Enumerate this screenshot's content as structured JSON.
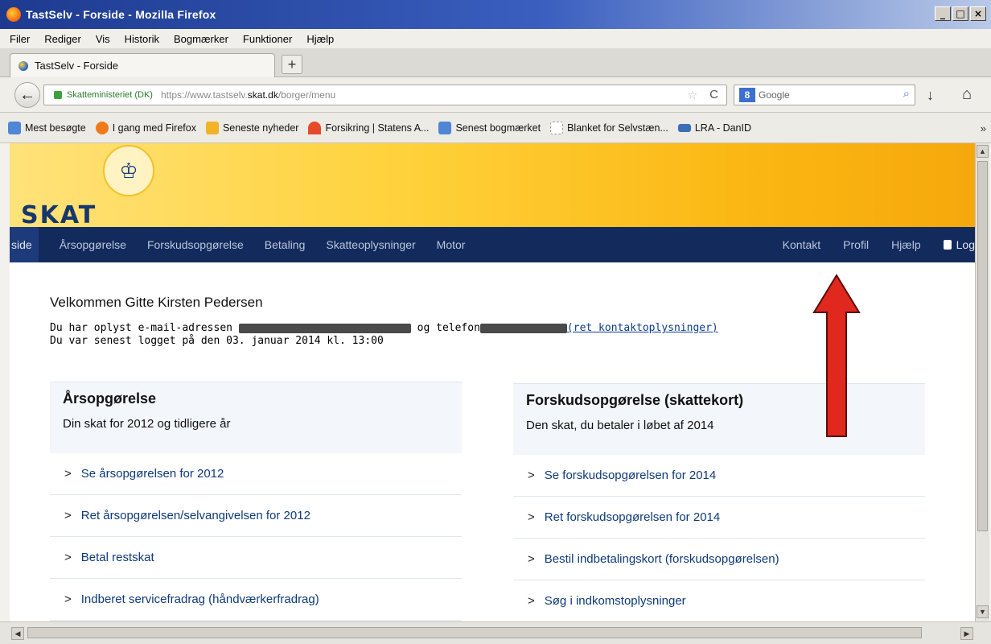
{
  "window": {
    "title": "TastSelv - Forside - Mozilla Firefox",
    "controls": [
      "_",
      "□",
      "×"
    ]
  },
  "menu": [
    "Filer",
    "Rediger",
    "Vis",
    "Historik",
    "Bogmærker",
    "Funktioner",
    "Hjælp"
  ],
  "tab": {
    "label": "TastSelv - Forside",
    "new_tab": "+"
  },
  "navbar": {
    "back": "←",
    "identity": "Skatteministeriet (DK)",
    "url_prefix": "https://www.tastselv.",
    "url_domain": "skat.dk",
    "url_suffix": "/borger/menu",
    "star": "☆",
    "reload": "C",
    "search_engine": "8",
    "search_placeholder": "Google",
    "search_go": "⌕",
    "download": "↓",
    "home": "⌂"
  },
  "bookmarks": [
    {
      "label": "Mest besøgte",
      "icon": "folder-icon",
      "color": "#4f86d6"
    },
    {
      "label": "I gang med Firefox",
      "icon": "firefox-icon",
      "color": "#f07a1a"
    },
    {
      "label": "Seneste nyheder",
      "icon": "rss-icon",
      "color": "#f2b328"
    },
    {
      "label": "Forsikring | Statens A...",
      "icon": "arc-icon",
      "color": "#e44a2b"
    },
    {
      "label": "Senest bogmærket",
      "icon": "folder-icon",
      "color": "#4f86d6"
    },
    {
      "label": "Blanket for Selvstæn...",
      "icon": "page-icon",
      "color": "#dddddd"
    },
    {
      "label": "LRA - DanID",
      "icon": "card-icon",
      "color": "#3b6fb6"
    }
  ],
  "bookmarks_more": "»",
  "site": {
    "logo": "SKAT",
    "crown": "♔",
    "nav_left": [
      "side",
      "Årsopgørelse",
      "Forskudsopgørelse",
      "Betaling",
      "Skatteoplysninger",
      "Motor"
    ],
    "nav_right": [
      "Kontakt",
      "Profil",
      "Hjælp"
    ],
    "logout": "Log",
    "welcome": "Velkommen Gitte Kirsten Pedersen",
    "info1_a": "Du har oplyst e-mail-adressen",
    "info1_b": "og telefon",
    "info1_link": "(ret kontaktoplysninger)",
    "info2": "Du var senest logget på den 03. januar 2014 kl. 13:00",
    "panels": [
      {
        "title": "Årsopgørelse",
        "subtitle": "Din skat for 2012 og tidligere år",
        "links": [
          "Se årsopgørelsen for 2012",
          "Ret årsopgørelsen/selvangivelsen for 2012",
          "Betal restskat",
          "Indberet servicefradrag (håndværkerfradrag)"
        ]
      },
      {
        "title": "Forskudsopgørelse (skattekort)",
        "subtitle": "Den skat, du betaler i løbet af 2014",
        "links": [
          "Se forskudsopgørelsen for 2014",
          "Ret forskudsopgørelsen for 2014",
          "Bestil indbetalingskort (forskudsopgørelsen)",
          "Søg i indkomstoplysninger"
        ]
      }
    ],
    "chevron": ">"
  },
  "colors": {
    "nav_bg": "#132a5c",
    "banner": "#ffd23c",
    "annotation_arrow": "#e0281e"
  }
}
